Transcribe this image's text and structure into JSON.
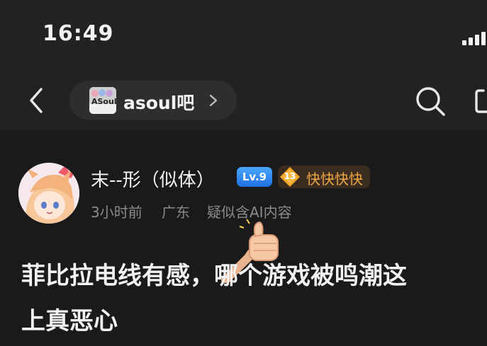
{
  "status_bar": {
    "time": "16:49"
  },
  "nav": {
    "forum_logo_text": "ASoul",
    "forum_name": "asoul吧"
  },
  "post": {
    "author": {
      "name": "末--形（似体）",
      "level": "Lv.9",
      "fan_level": "13",
      "fan_title": "快快快快"
    },
    "meta": {
      "time": "3小时前",
      "location": "广东",
      "ai_flag": "疑似含AI内容"
    },
    "title_line1": "菲比拉电线有感，哪个游戏被鸣潮这",
    "title_line2": "上真恶心"
  },
  "colors": {
    "background": "#1a1a1a",
    "bar": "#222224",
    "level_badge": "#2f86f0",
    "fan_badge": "#f0a746"
  }
}
